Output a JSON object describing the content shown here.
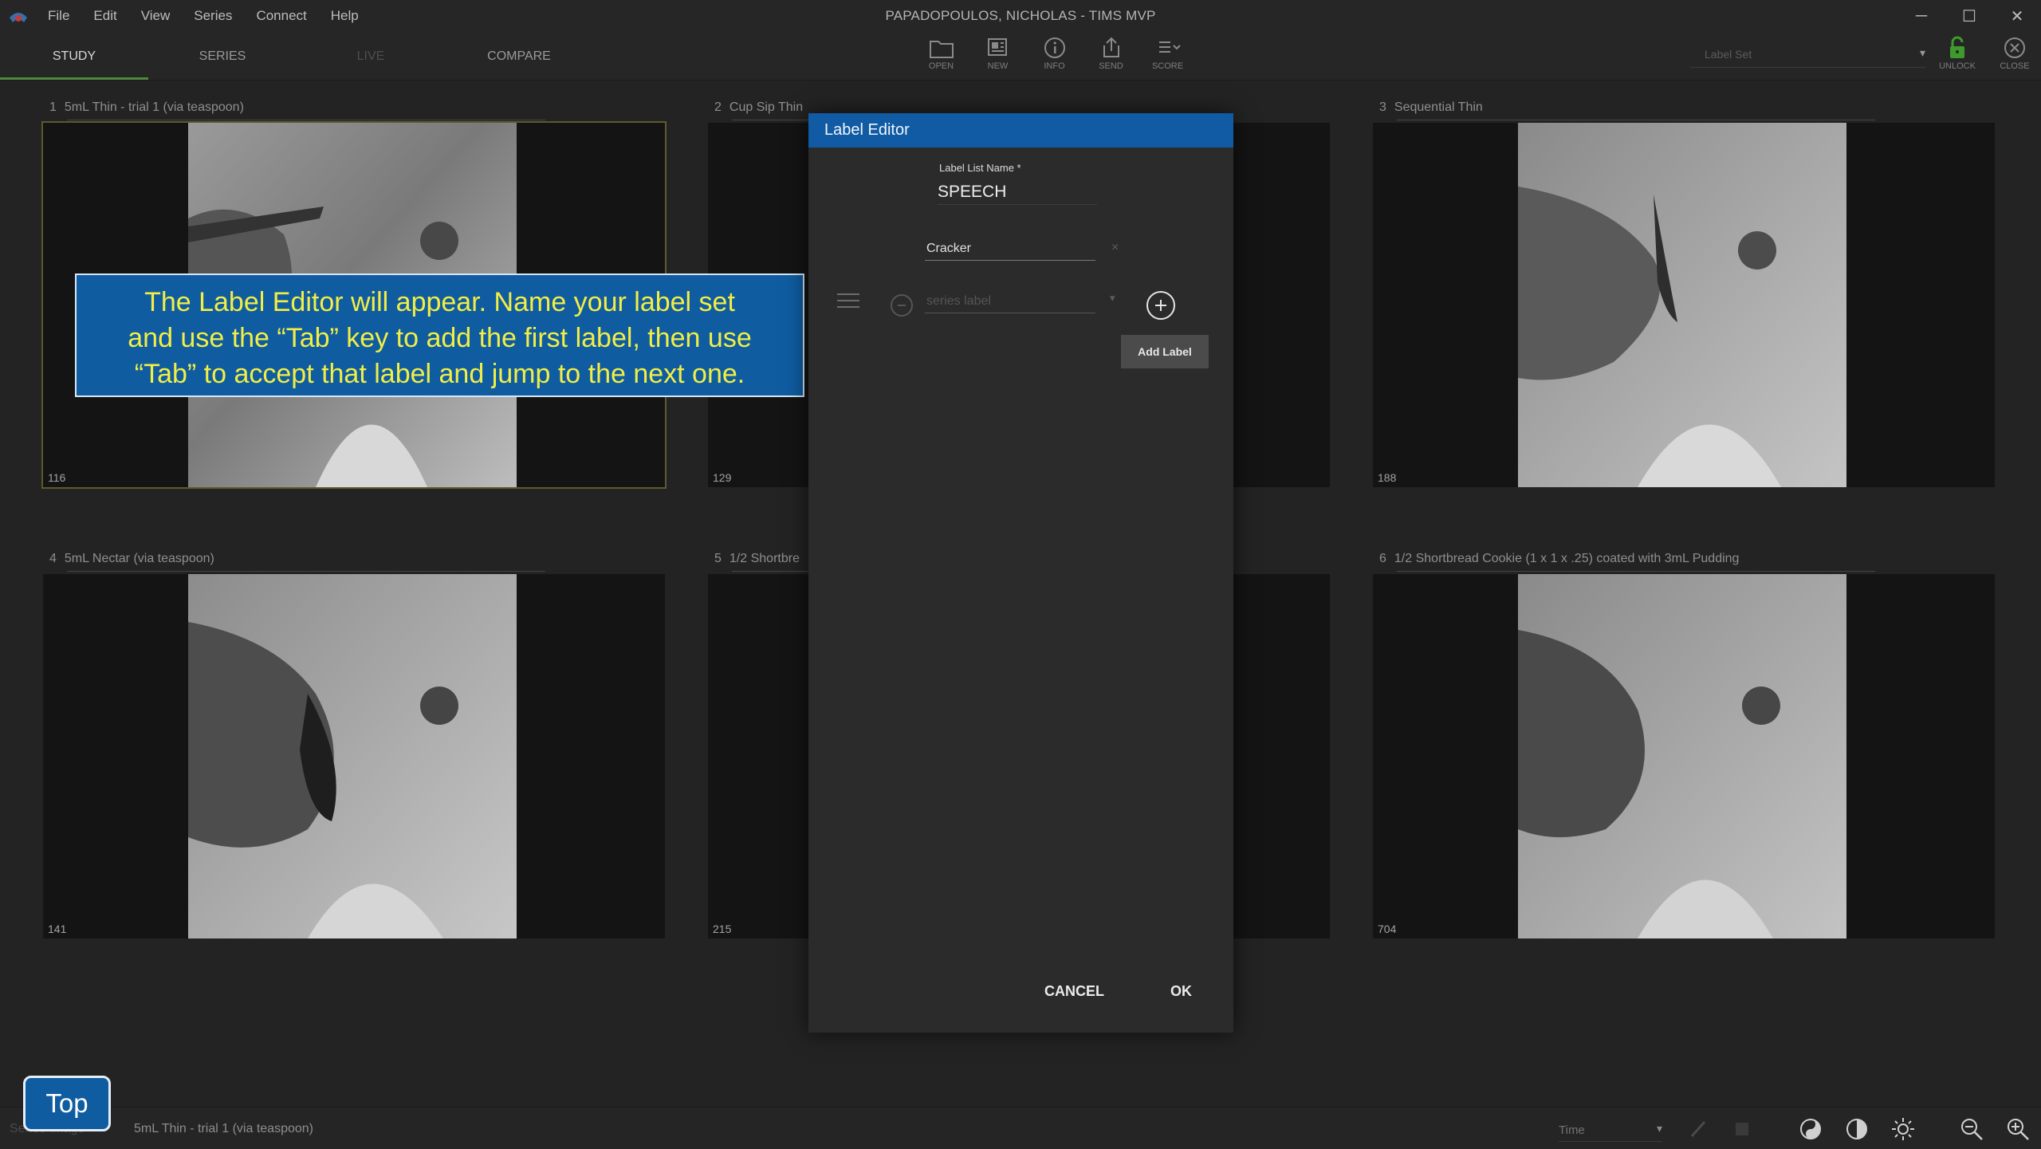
{
  "window": {
    "title": "PAPADOPOULOS, NICHOLAS - TIMS MVP",
    "minimize_glyph": "─",
    "maximize_glyph": "☐",
    "close_glyph": "✕"
  },
  "menu": [
    "File",
    "Edit",
    "View",
    "Series",
    "Connect",
    "Help"
  ],
  "tabs": [
    "STUDY",
    "SERIES",
    "LIVE",
    "COMPARE"
  ],
  "active_tab": "STUDY",
  "toolbar": {
    "tools": [
      {
        "label": "OPEN",
        "icon": "folder-icon"
      },
      {
        "label": "NEW",
        "icon": "new-series-icon"
      },
      {
        "label": "INFO",
        "icon": "info-icon"
      },
      {
        "label": "SEND",
        "icon": "send-icon"
      },
      {
        "label": "SCORE",
        "icon": "score-icon"
      }
    ],
    "label_set_placeholder": "Label Set",
    "unlock_label": "UNLOCK",
    "close_label": "CLOSE"
  },
  "series": [
    {
      "num": "1",
      "title": "5mL Thin - trial 1 (via teaspoon)",
      "count": "116"
    },
    {
      "num": "2",
      "title": "Cup Sip Thin",
      "count": "129"
    },
    {
      "num": "3",
      "title": "Sequential Thin",
      "count": "188"
    },
    {
      "num": "4",
      "title": "5mL Nectar (via teaspoon)",
      "count": "141"
    },
    {
      "num": "5",
      "title": "1/2 Shortbre",
      "count": "215"
    },
    {
      "num": "6",
      "title": "1/2 Shortbread Cookie (1 x 1 x .25) coated with 3mL Pudding",
      "count": "704"
    }
  ],
  "callout": "The Label Editor will appear. Name your label set\nand use the “Tab” key to add the first label, then use\n“Tab” to accept that label and jump to the next one.",
  "dialog": {
    "title": "Label Editor",
    "list_name_label": "Label List Name *",
    "list_name_value": "SPEECH",
    "label_1": "Cracker",
    "label_2_placeholder": "series label",
    "clear_glyph": "×",
    "add_label": "Add Label",
    "cancel": "CANCEL",
    "ok": "OK"
  },
  "statusbar": {
    "left_text": "Series Image",
    "series_name": "5mL Thin - trial 1 (via teaspoon)",
    "time_label": "Time"
  },
  "top_button": "Top",
  "colors": {
    "accent_blue": "#105ba4",
    "callout_text": "#f2ee45",
    "active_tab_underline": "#4f8a3c",
    "unlock_green": "#3f9a2e"
  }
}
